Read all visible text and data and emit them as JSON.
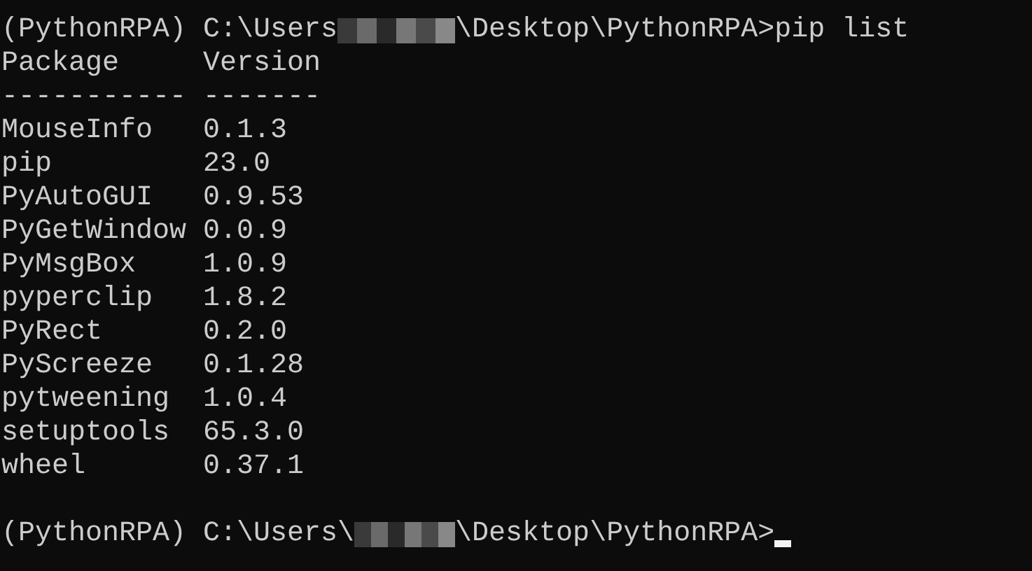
{
  "command_prompt": {
    "prefix": "(PythonRPA) C:\\Users",
    "suffix": "\\Desktop\\PythonRPA>",
    "command": "pip list"
  },
  "table": {
    "columns": [
      "Package",
      "Version"
    ],
    "rules": [
      "-----------",
      "-------"
    ],
    "rows": [
      [
        "MouseInfo",
        "0.1.3"
      ],
      [
        "pip",
        "23.0"
      ],
      [
        "PyAutoGUI",
        "0.9.53"
      ],
      [
        "PyGetWindow",
        "0.0.9"
      ],
      [
        "PyMsgBox",
        "1.0.9"
      ],
      [
        "pyperclip",
        "1.8.2"
      ],
      [
        "PyRect",
        "0.2.0"
      ],
      [
        "PyScreeze",
        "0.1.28"
      ],
      [
        "pytweening",
        "1.0.4"
      ],
      [
        "setuptools",
        "65.3.0"
      ],
      [
        "wheel",
        "0.37.1"
      ]
    ]
  },
  "final_prompt": {
    "prefix": "(PythonRPA) C:\\Users\\",
    "suffix": "\\Desktop\\PythonRPA>"
  }
}
